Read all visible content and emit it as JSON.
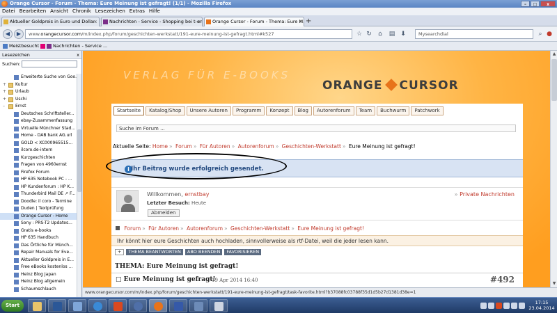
{
  "window": {
    "title": "Orange Cursor - Forum - Thema: Eure Meinung ist gefragt! (1/1) - Mozilla Firefox",
    "min": "–",
    "max": "□",
    "close": "x"
  },
  "menu": [
    "Datei",
    "Bearbeiten",
    "Ansicht",
    "Chronik",
    "Lesezeichen",
    "Extras",
    "Hilfe"
  ],
  "tabs": [
    {
      "label": "Aktueller Goldpreis in Euro und Dollar",
      "close": "x"
    },
    {
      "label": "Nachrichten - Service - Shopping bei t-onl...",
      "close": "x"
    },
    {
      "label": "Orange Cursor - Forum - Thema: Eure M...",
      "close": "x"
    }
  ],
  "new_tab": "+",
  "nav": {
    "back": "◀",
    "forward": "▶",
    "url_prefix": "www.",
    "url_domain": "orangecursor.com",
    "url_rest": "/m/index.php/forum/geschichten-werkstatt/191-eure-meinung-ist-gefragt.html#k527",
    "search_placeholder": "Mysearchdial"
  },
  "bookmarks": [
    {
      "label": "Meistbesucht"
    },
    {
      "label": "Nachrichten - Service ..."
    }
  ],
  "sidebar": {
    "title": "Lesezeichen",
    "close": "x",
    "search_label": "Suchen:",
    "items": [
      {
        "label": "Erweiterte Suche von Goo...",
        "kind": "link"
      },
      {
        "label": "Kultur",
        "kind": "folder",
        "twist": "+"
      },
      {
        "label": "Urlaub",
        "kind": "folder",
        "twist": "+"
      },
      {
        "label": "Uschi",
        "kind": "folder",
        "twist": "+"
      },
      {
        "label": "Ernst",
        "kind": "folder",
        "twist": "–"
      },
      {
        "label": "Deutsches Schriftsteller...",
        "kind": "link"
      },
      {
        "label": "ebay-Zusammenfassung",
        "kind": "link"
      },
      {
        "label": "Virtuelle Münchner Stad...",
        "kind": "link"
      },
      {
        "label": "Home - DAB bank AG.url",
        "kind": "link"
      },
      {
        "label": "GOLD < XC000965515...",
        "kind": "link"
      },
      {
        "label": "ilcoro.de-intern",
        "kind": "link"
      },
      {
        "label": "Kurzgeschichten",
        "kind": "link"
      },
      {
        "label": "Fragen von 4960ernst",
        "kind": "link"
      },
      {
        "label": "Firefox Forum",
        "kind": "link"
      },
      {
        "label": "HP 635 Notebook PC - ...",
        "kind": "link"
      },
      {
        "label": "HP Kundenforum : HP K...",
        "kind": "link"
      },
      {
        "label": "Thunderbird Mail DE ↗ F...",
        "kind": "link"
      },
      {
        "label": "Doodle: il coro - Termine",
        "kind": "link"
      },
      {
        "label": "Duden | Textprüfung",
        "kind": "link"
      },
      {
        "label": "Orange Cursor - Home",
        "kind": "link",
        "selected": true
      },
      {
        "label": "Sony : PRS-T2 Updates...",
        "kind": "link"
      },
      {
        "label": "Gratis e-books",
        "kind": "link"
      },
      {
        "label": "HP 635 Handbuch",
        "kind": "link"
      },
      {
        "label": "Das Örtliche für Münch...",
        "kind": "link"
      },
      {
        "label": "Repair Manuals for Eve...",
        "kind": "link"
      },
      {
        "label": "Aktueller Goldpreis in E...",
        "kind": "link"
      },
      {
        "label": "Free eBooks kostenlos ...",
        "kind": "link"
      },
      {
        "label": "Heinz Blog Japan",
        "kind": "link"
      },
      {
        "label": "Heinz Blog allgemein",
        "kind": "link"
      },
      {
        "label": "Schaumschlauch",
        "kind": "link"
      }
    ]
  },
  "site": {
    "verlag": "VERLAG FÜR E-BOOKS",
    "logo_left": "ORANGE",
    "logo_right": "CURSOR",
    "navtabs": [
      "Startseite",
      "Katalog/Shop",
      "Unsere Autoren",
      "Programm",
      "Konzept",
      "Blog",
      "Autorenforum",
      "Team",
      "Buchwurm",
      "Patchwork"
    ],
    "forum_search": "Suche im Forum ...",
    "breadcrumb": {
      "prefix": "Aktuelle Seite:",
      "links": [
        "Home",
        "Forum",
        "Für Autoren",
        "Autorenforum",
        "Geschichten-Werkstatt"
      ],
      "current": "Eure Meinung ist gefragt!",
      "sep": "»"
    },
    "success_icon": "i",
    "success": "Ihr Beitrag wurde erfolgreich gesendet.",
    "welcome_prefix": "Willkommen,",
    "username": "ernstbay",
    "last_visit_label": "Letzter Besuch:",
    "last_visit": "Heute",
    "logout": "Abmelden",
    "pm_icon": "»",
    "pm": "Private Nachrichten",
    "breadcrumb2": [
      "Forum",
      "Für Autoren",
      "Autorenforum",
      "Geschichten-Werkstatt",
      "Eure Meinung ist gefragt!"
    ],
    "info": "Ihr könnt hier eure Geschichten auch hochladen, sinnvollerweise als rtf-Datei, weil die jeder lesen kann.",
    "actions": [
      "+",
      "THEMA BEANTWORTEN",
      "ABO BEENDEN",
      "FAVORISIEREN"
    ],
    "thread_title": "THEMA: Eure Meinung ist gefragt!",
    "post": {
      "title": "Eure Meinung ist gefragt!",
      "date": "19 Apr 2014 16:40",
      "number": "#492",
      "icon": "□"
    }
  },
  "statusbar": "www.orangecursor.com/m/index.php/forum/geschichten-werkstatt/191-eure-meinung-ist-gefragt/task-favorite.html?b37088fc03788f35d1d5b27d1381d38e=1",
  "taskbar": {
    "start": "Start",
    "time": "17:15",
    "date": "23.04.2014"
  }
}
